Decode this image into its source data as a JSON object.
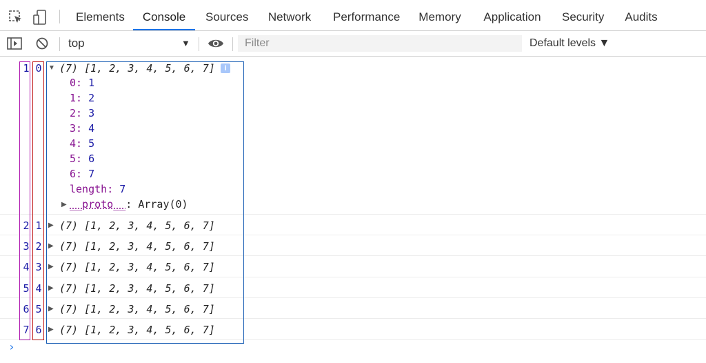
{
  "tabs": [
    {
      "label": "Elements"
    },
    {
      "label": "Console"
    },
    {
      "label": "Sources"
    },
    {
      "label": "Network"
    },
    {
      "label": "Performance"
    },
    {
      "label": "Memory"
    },
    {
      "label": "Application"
    },
    {
      "label": "Security"
    },
    {
      "label": "Audits"
    }
  ],
  "active_tab": "Console",
  "toolbar": {
    "context": "top",
    "context_arrow": "▼",
    "filter_placeholder": "Filter",
    "levels": "Default levels ▼"
  },
  "console": {
    "rows": [
      {
        "line": "1",
        "index": "0",
        "summary": "(7) [1, 2, 3, 4, 5, 6, 7]",
        "expanded": true
      },
      {
        "line": "2",
        "index": "1",
        "summary": "(7) [1, 2, 3, 4, 5, 6, 7]",
        "expanded": false
      },
      {
        "line": "3",
        "index": "2",
        "summary": "(7) [1, 2, 3, 4, 5, 6, 7]",
        "expanded": false
      },
      {
        "line": "4",
        "index": "3",
        "summary": "(7) [1, 2, 3, 4, 5, 6, 7]",
        "expanded": false
      },
      {
        "line": "5",
        "index": "4",
        "summary": "(7) [1, 2, 3, 4, 5, 6, 7]",
        "expanded": false
      },
      {
        "line": "6",
        "index": "5",
        "summary": "(7) [1, 2, 3, 4, 5, 6, 7]",
        "expanded": false
      },
      {
        "line": "7",
        "index": "6",
        "summary": "(7) [1, 2, 3, 4, 5, 6, 7]",
        "expanded": false
      }
    ],
    "expanded_props": [
      {
        "key": "0",
        "value": "1"
      },
      {
        "key": "1",
        "value": "2"
      },
      {
        "key": "2",
        "value": "3"
      },
      {
        "key": "3",
        "value": "4"
      },
      {
        "key": "4",
        "value": "5"
      },
      {
        "key": "5",
        "value": "6"
      },
      {
        "key": "6",
        "value": "7"
      },
      {
        "key": "length",
        "value": "7"
      }
    ],
    "proto_key": "__proto__",
    "proto_value": "Array(0)",
    "info_badge": "i",
    "prompt": "›"
  },
  "colors": {
    "accent": "#1a73e8",
    "number": "#1a1aa6",
    "property_key": "#881391",
    "box_line": "#b01ab0",
    "box_index": "#c01a1a",
    "box_output": "#1a5fb4"
  },
  "icons": [
    "inspect-element-icon",
    "device-toolbar-icon",
    "sidebar-toggle-icon",
    "clear-console-icon",
    "eye-icon",
    "expand-triangle-icon",
    "collapse-triangle-icon",
    "info-icon",
    "prompt-chevron-icon"
  ]
}
